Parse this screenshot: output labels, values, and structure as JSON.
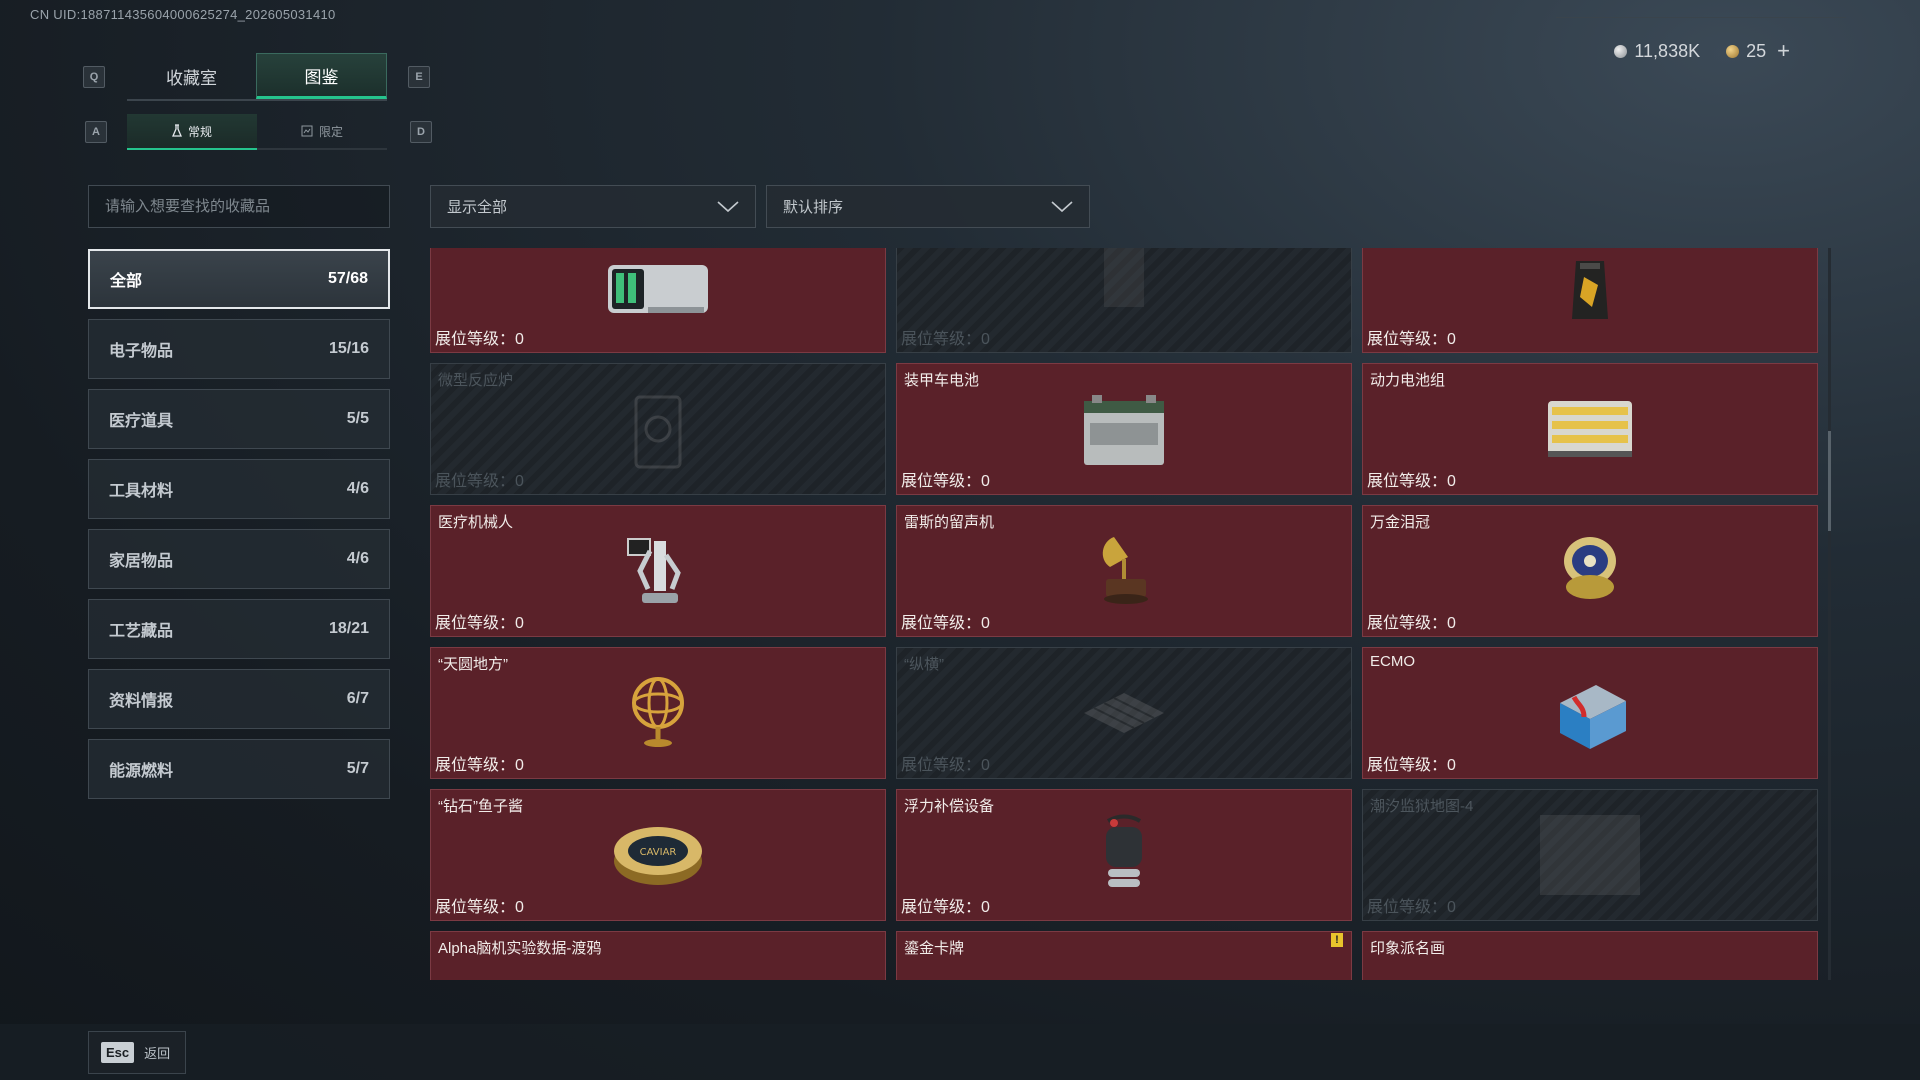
{
  "uid_text": "CN UID:1887114356040006252​74_202605031410",
  "keys": {
    "q": "Q",
    "e": "E",
    "a": "A",
    "d": "D"
  },
  "tabs": {
    "collection_room": "收藏室",
    "catalog": "图鉴"
  },
  "subtabs": {
    "regular": "常规",
    "limited": "限定"
  },
  "currency": {
    "silver": "11,838K",
    "gold": "25",
    "plus": "+"
  },
  "search": {
    "placeholder": "请输入想要查找的收藏品"
  },
  "categories": [
    {
      "label": "全部",
      "count": "57/68"
    },
    {
      "label": "电子物品",
      "count": "15/16"
    },
    {
      "label": "医疗道具",
      "count": "5/5"
    },
    {
      "label": "工具材料",
      "count": "4/6"
    },
    {
      "label": "家居物品",
      "count": "4/6"
    },
    {
      "label": "工艺藏品",
      "count": "18/21"
    },
    {
      "label": "资料情报",
      "count": "6/7"
    },
    {
      "label": "能源燃料",
      "count": "5/7"
    }
  ],
  "filters": {
    "show": "显示全部",
    "sort": "默认排序"
  },
  "items": [
    {
      "name": "",
      "level": "展位等级：0",
      "icon": "server-icon"
    },
    {
      "name": "",
      "level": "展位等级：0",
      "icon": "unknown-item-icon"
    },
    {
      "name": "",
      "level": "展位等级：0",
      "icon": "coffee-bag-icon"
    },
    {
      "name": "微型反应炉",
      "level": "展位等级：0",
      "icon": "reactor-icon"
    },
    {
      "name": "装甲车电池",
      "level": "展位等级：0",
      "icon": "battery-icon"
    },
    {
      "name": "动力电池组",
      "level": "展位等级：0",
      "icon": "battery-pack-icon"
    },
    {
      "name": "医疗机械人",
      "level": "展位等级：0",
      "icon": "medical-robot-icon"
    },
    {
      "name": "雷斯的留声机",
      "level": "展位等级：0",
      "icon": "gramophone-icon"
    },
    {
      "name": "万金泪冠",
      "level": "展位等级：0",
      "icon": "jeweled-egg-icon"
    },
    {
      "name": "“天圆地方”",
      "level": "展位等级：0",
      "icon": "armillary-sphere-icon"
    },
    {
      "name": "“纵横”",
      "level": "展位等级：0",
      "icon": "chessboard-icon"
    },
    {
      "name": "ECMO",
      "level": "展位等级：0",
      "icon": "ecmo-icon"
    },
    {
      "name": "“钻石”鱼子酱",
      "level": "展位等级：0",
      "icon": "caviar-tin-icon"
    },
    {
      "name": "浮力补偿设备",
      "level": "展位等级：0",
      "icon": "diving-gear-icon"
    },
    {
      "name": "潮汐监狱地图-4",
      "level": "展位等级：0",
      "icon": "map-icon"
    },
    {
      "name": "Alpha脑机实验数据-渡鸦",
      "level": "",
      "icon": "data-drive-icon"
    },
    {
      "name": "鎏金卡牌",
      "level": "",
      "icon": "gilded-card-icon"
    },
    {
      "name": "印象派名画",
      "level": "",
      "icon": "painting-icon"
    }
  ],
  "caviar_label": "CAVIAR",
  "back": {
    "key": "Esc",
    "label": "返回"
  }
}
